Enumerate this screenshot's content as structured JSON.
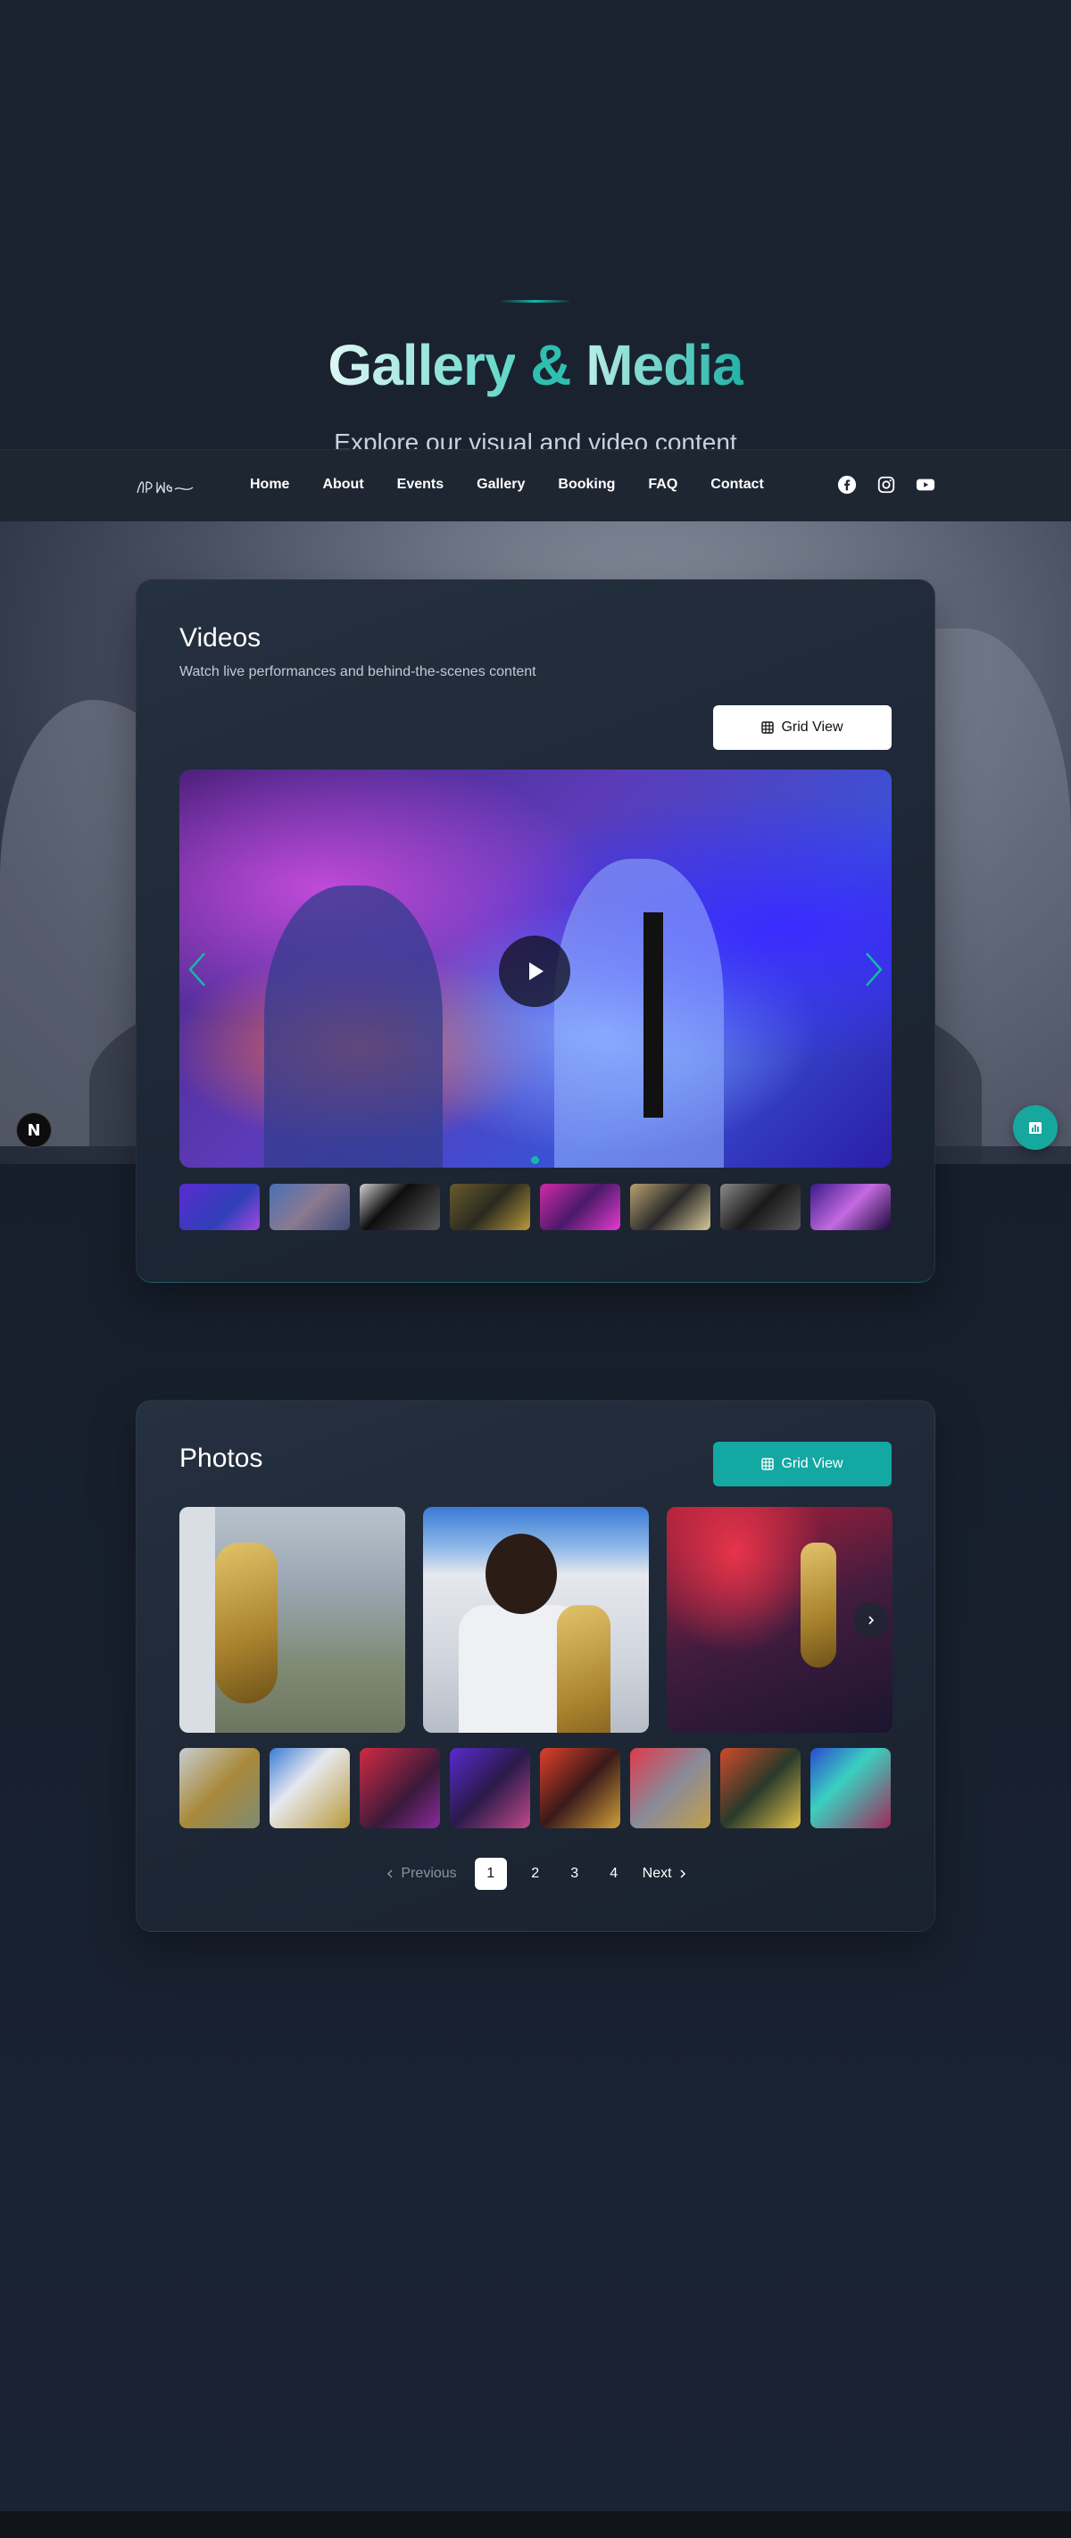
{
  "hero": {
    "title_part1": "Gallery",
    "title_amp": "&",
    "title_part2": "Media",
    "subtitle": "Explore our visual and video content"
  },
  "nav": {
    "logo_text": "DPMG",
    "links": [
      "Home",
      "About",
      "Events",
      "Gallery",
      "Booking",
      "FAQ",
      "Contact"
    ],
    "socials": [
      "facebook-icon",
      "instagram-icon",
      "youtube-icon"
    ]
  },
  "videos": {
    "title": "Videos",
    "subtitle": "Watch live performances and behind-the-scenes content",
    "grid_button": "Grid View",
    "thumbnail_count": 8
  },
  "photos": {
    "title": "Photos",
    "grid_button": "Grid View",
    "pagination": {
      "previous": "Previous",
      "pages": [
        "1",
        "2",
        "3",
        "4"
      ],
      "active": "1",
      "next": "Next"
    }
  },
  "floating": {
    "left_badge": "N"
  },
  "colors": {
    "accent": "#14a8a3",
    "background": "#1a2230",
    "card": "#1f2836"
  }
}
